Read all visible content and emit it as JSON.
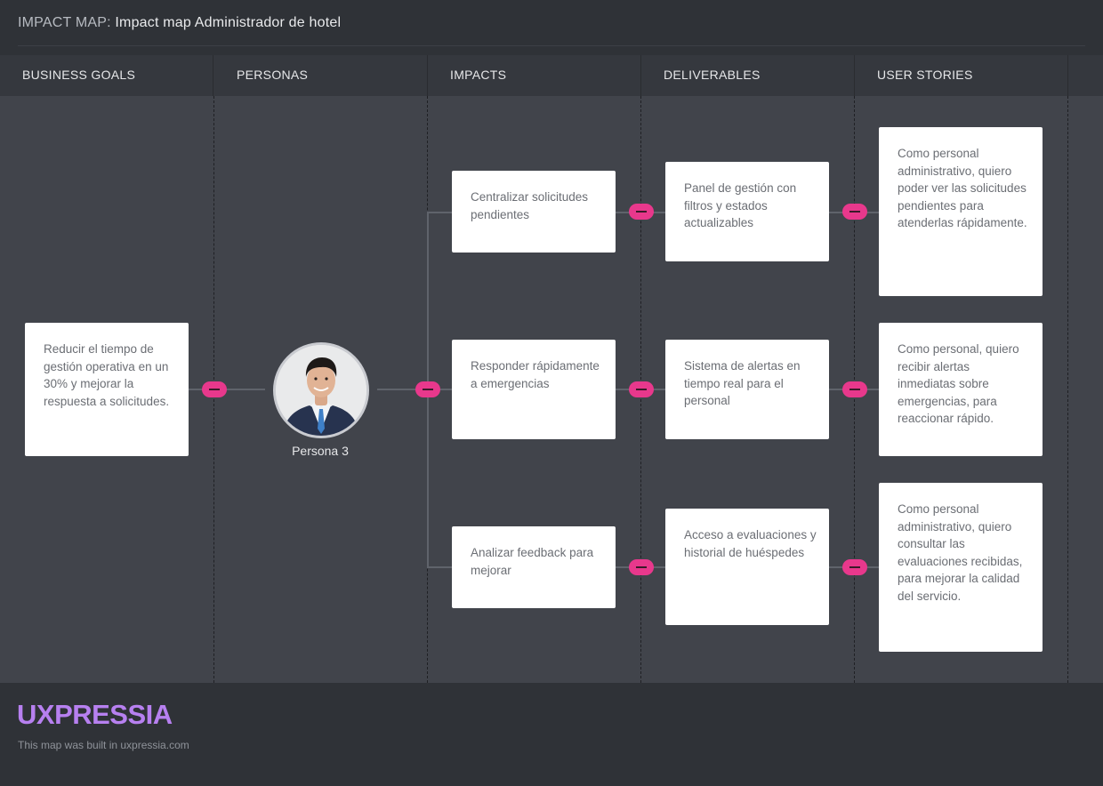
{
  "header": {
    "label": "IMPACT MAP:",
    "title": "Impact map Administrador de hotel"
  },
  "columns": [
    "BUSINESS GOALS",
    "PERSONAS",
    "IMPACTS",
    "DELIVERABLES",
    "USER STORIES"
  ],
  "goal": "Reducir el tiempo de gestión operativa en un 30% y mejorar la respuesta a solicitudes.",
  "persona": {
    "name": "Persona 3",
    "icon": "persona-avatar-icon"
  },
  "impacts": [
    "Centralizar solicitudes pendientes",
    "Responder rápidamente a emergencias",
    "Analizar feedback para mejorar"
  ],
  "deliverables": [
    "Panel de gestión con filtros y estados actualizables",
    "Sistema de alertas en tiempo real para el personal",
    "Acceso a evaluaciones y historial de huéspedes"
  ],
  "user_stories": [
    "Como personal administrativo, quiero poder ver las solicitudes pendientes para atenderlas rápidamente.",
    "Como personal, quiero recibir alertas inmediatas sobre emergencias, para reaccionar rápido.",
    "Como personal administrativo, quiero consultar las evaluaciones recibidas, para mejorar la calidad del servicio."
  ],
  "footer": {
    "logo": "UXPRESSIA",
    "note": "This map was built in uxpressia.com"
  },
  "colors": {
    "background": "#41444b",
    "card": "#ffffff",
    "collapse_button": "#e8388c",
    "logo": "#b780f0"
  }
}
